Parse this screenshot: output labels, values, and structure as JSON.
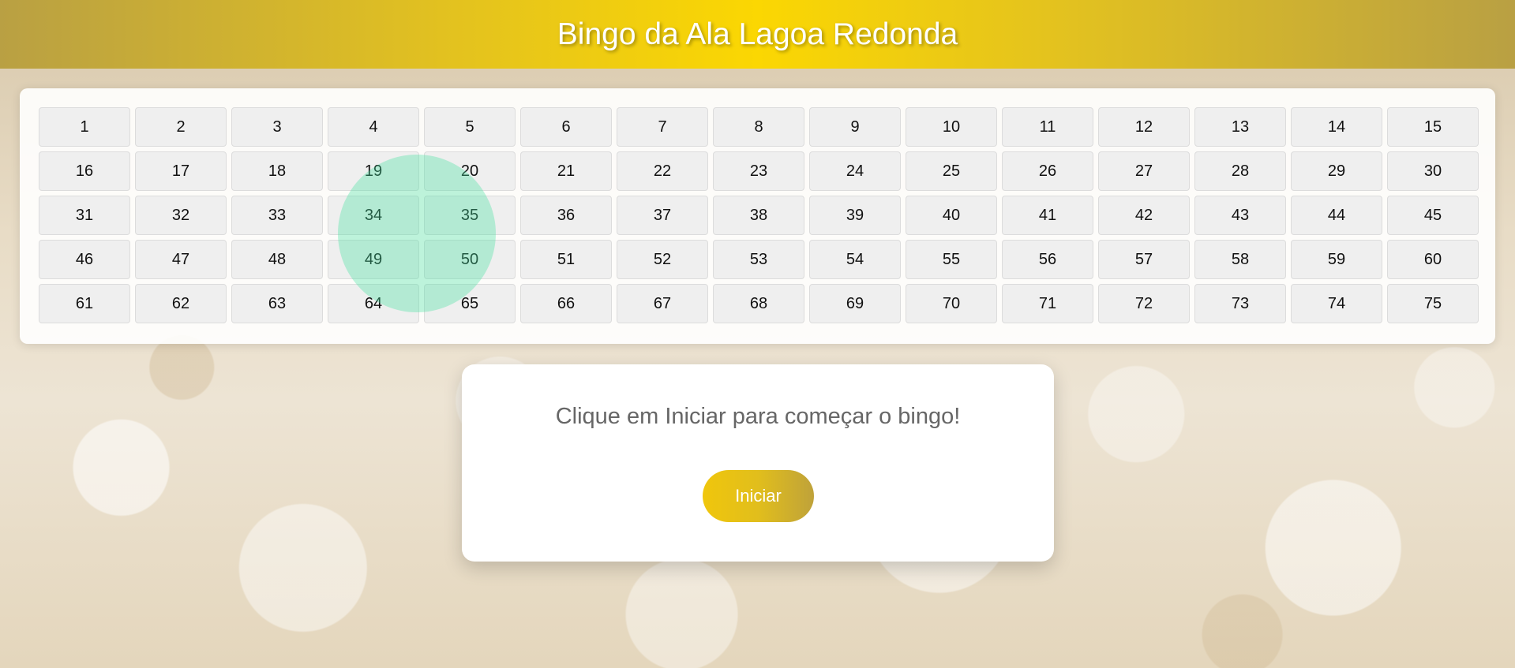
{
  "header": {
    "title": "Bingo da Ala Lagoa Redonda"
  },
  "board": {
    "numbers": [
      "1",
      "2",
      "3",
      "4",
      "5",
      "6",
      "7",
      "8",
      "9",
      "10",
      "11",
      "12",
      "13",
      "14",
      "15",
      "16",
      "17",
      "18",
      "19",
      "20",
      "21",
      "22",
      "23",
      "24",
      "25",
      "26",
      "27",
      "28",
      "29",
      "30",
      "31",
      "32",
      "33",
      "34",
      "35",
      "36",
      "37",
      "38",
      "39",
      "40",
      "41",
      "42",
      "43",
      "44",
      "45",
      "46",
      "47",
      "48",
      "49",
      "50",
      "51",
      "52",
      "53",
      "54",
      "55",
      "56",
      "57",
      "58",
      "59",
      "60",
      "61",
      "62",
      "63",
      "64",
      "65",
      "66",
      "67",
      "68",
      "69",
      "70",
      "71",
      "72",
      "73",
      "74",
      "75"
    ]
  },
  "panel": {
    "message": "Clique em Iniciar para começar o bingo!",
    "start_label": "Iniciar"
  },
  "colors": {
    "header_gold": "#fbd702",
    "button_gold": "#f0c60c",
    "highlight_green": "#46e1a0"
  }
}
